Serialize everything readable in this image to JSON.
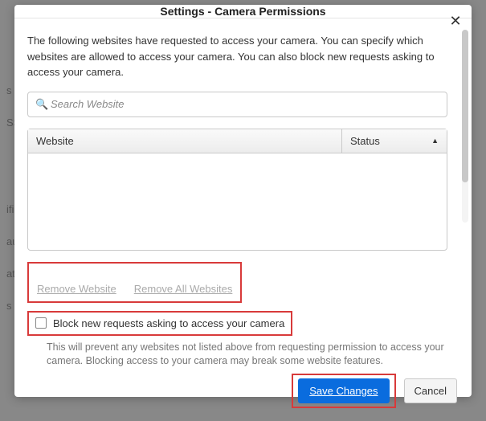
{
  "dialog": {
    "title": "Settings - Camera Permissions"
  },
  "description": "The following websites have requested to access your camera. You can specify which websites are allowed to access your camera. You can also block new requests asking to access your camera.",
  "search": {
    "placeholder": "Search Website"
  },
  "table": {
    "col_website": "Website",
    "col_status": "Status"
  },
  "buttons": {
    "remove_website": "Remove Website",
    "remove_all": "Remove All Websites",
    "save": "Save Changes",
    "cancel": "Cancel"
  },
  "block": {
    "label": "Block new requests asking to access your camera",
    "hint": "This will prevent any websites not listed above from requesting permission to access your camera. Blocking access to your camera may break some website features."
  },
  "backdrop": {
    "l1": "s",
    "l2": "SS",
    "l3": "ific",
    "l4": "au",
    "l5": "atio",
    "l6": "s"
  }
}
